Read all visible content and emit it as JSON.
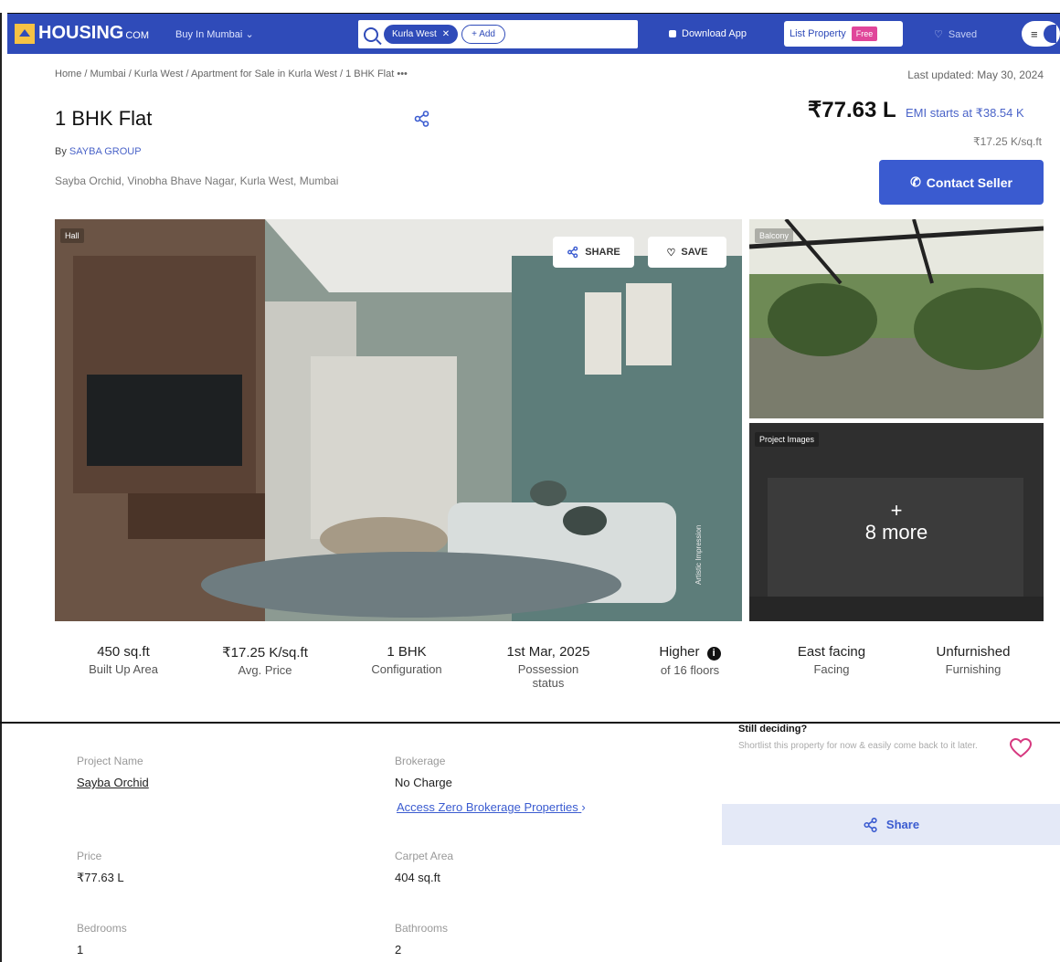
{
  "nav": {
    "logo": "HOUSING",
    "logo_suffix": "COM",
    "city": "Buy In Mumbai",
    "chip": "Kurla West",
    "add": "+ Add",
    "download": "Download App",
    "list_property": "List Property",
    "free": "Free",
    "saved": "Saved"
  },
  "breadcrumb": "Home / Mumbai / Kurla West / Apartment for Sale in Kurla West / 1 BHK Flat  •••",
  "last_updated": "Last updated: May 30, 2024",
  "listing": {
    "title": "1 BHK Flat",
    "by_prefix": "By",
    "builder": "SAYBA GROUP",
    "address": "Sayba Orchid, Vinobha Bhave Nagar, Kurla West, Mumbai",
    "price": "₹77.63 L",
    "emi": "EMI starts at ₹38.54 K",
    "per_sqft": "₹17.25 K/sq.ft",
    "contact": "Contact Seller"
  },
  "gallery": {
    "main_tag": "Hall",
    "share": "SHARE",
    "save": "SAVE",
    "watermark": "Artistic Impression",
    "side1_tag": "Balcony",
    "side2_tag": "Project Images",
    "more_plus": "+",
    "more_count": "8 more"
  },
  "stats": [
    {
      "value": "450 sq.ft",
      "label": "Built Up Area"
    },
    {
      "value": "₹17.25 K/sq.ft",
      "label": "Avg. Price"
    },
    {
      "value": "1 BHK",
      "label": "Configuration"
    },
    {
      "value": "1st Mar, 2025",
      "label": "Possession status"
    },
    {
      "value": "Higher",
      "label": "of 16 floors"
    },
    {
      "value": "East facing",
      "label": "Facing"
    },
    {
      "value": "Unfurnished",
      "label": "Furnishing"
    }
  ],
  "details": {
    "project_name_key": "Project Name",
    "project_name": "Sayba Orchid",
    "brokerage_key": "Brokerage",
    "brokerage": "No Charge",
    "access": "Access Zero Brokerage Properties",
    "access_arrow": "›",
    "price_key": "Price",
    "price": "₹77.63 L",
    "carpet_key": "Carpet Area",
    "carpet": "404 sq.ft",
    "bedrooms_key": "Bedrooms",
    "bedrooms": "1",
    "bathrooms_key": "Bathrooms",
    "bathrooms": "2"
  },
  "deciding": {
    "heading": "Still deciding?",
    "sub": "Shortlist this property for now & easily come back to it later.",
    "share": "Share"
  },
  "colors": {
    "brand": "#2f4bb9",
    "accent": "#3a5bd0",
    "free_badge": "#e0469a",
    "heart": "#d6387f"
  }
}
